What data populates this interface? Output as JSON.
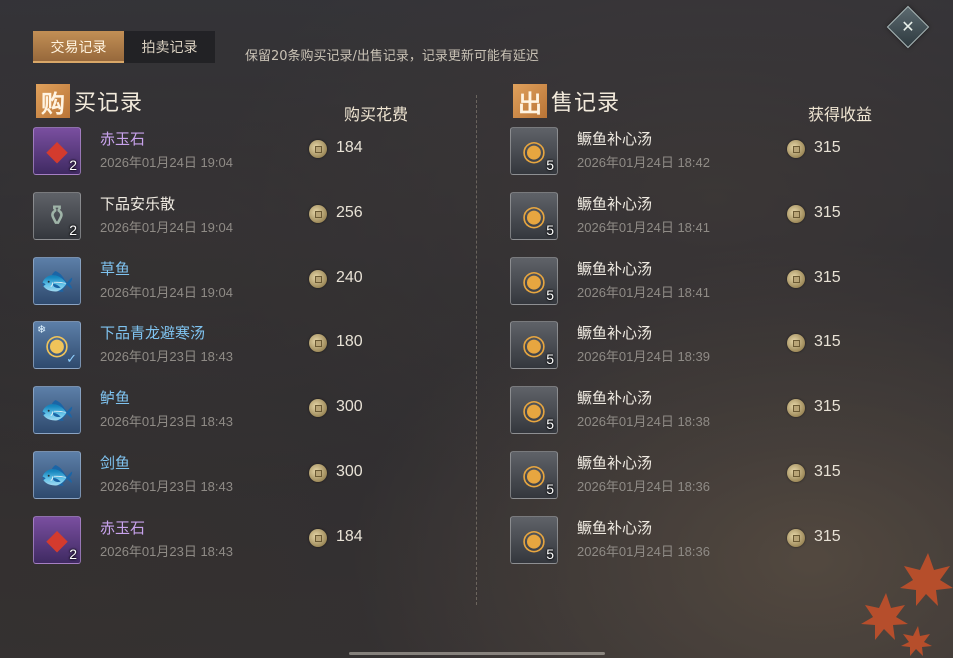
{
  "tabs": [
    {
      "label": "交易记录",
      "active": true
    },
    {
      "label": "拍卖记录",
      "active": false
    }
  ],
  "notice": "保留20条购买记录/出售记录，记录更新可能有延迟",
  "close_icon": "close-diamond-icon",
  "buy": {
    "title_char": "购",
    "title_rest": "买记录",
    "col_header": "购买花费",
    "items": [
      {
        "name": "赤玉石",
        "name_color": "purple",
        "time": "2026年01月24日 19:04",
        "amount": "184",
        "qty": "2",
        "icon": "red-gem-icon",
        "frame": "purple"
      },
      {
        "name": "下品安乐散",
        "name_color": "white",
        "time": "2026年01月24日 19:04",
        "amount": "256",
        "qty": "2",
        "icon": "medicine-jar-icon",
        "frame": "gray"
      },
      {
        "name": "草鱼",
        "name_color": "blue",
        "time": "2026年01月24日 19:04",
        "amount": "240",
        "qty": "",
        "icon": "grass-carp-icon",
        "frame": "blue"
      },
      {
        "name": "下品青龙避寒汤",
        "name_color": "blue",
        "time": "2026年01月23日 18:43",
        "amount": "180",
        "qty": "",
        "icon": "soup-bowl-icon",
        "frame": "blue"
      },
      {
        "name": "鲈鱼",
        "name_color": "blue",
        "time": "2026年01月23日 18:43",
        "amount": "300",
        "qty": "",
        "icon": "perch-fish-icon",
        "frame": "blue"
      },
      {
        "name": "剑鱼",
        "name_color": "blue",
        "time": "2026年01月23日 18:43",
        "amount": "300",
        "qty": "",
        "icon": "swordfish-icon",
        "frame": "blue"
      },
      {
        "name": "赤玉石",
        "name_color": "purple",
        "time": "2026年01月23日 18:43",
        "amount": "184",
        "qty": "2",
        "icon": "red-gem-icon",
        "frame": "purple"
      }
    ]
  },
  "sell": {
    "title_char": "出",
    "title_rest": "售记录",
    "col_header": "获得收益",
    "items": [
      {
        "name": "鳜鱼补心汤",
        "name_color": "white",
        "time": "2026年01月24日 18:42",
        "amount": "315",
        "qty": "5",
        "icon": "fish-soup-icon",
        "frame": "gray"
      },
      {
        "name": "鳜鱼补心汤",
        "name_color": "white",
        "time": "2026年01月24日 18:41",
        "amount": "315",
        "qty": "5",
        "icon": "fish-soup-icon",
        "frame": "gray"
      },
      {
        "name": "鳜鱼补心汤",
        "name_color": "white",
        "time": "2026年01月24日 18:41",
        "amount": "315",
        "qty": "5",
        "icon": "fish-soup-icon",
        "frame": "gray"
      },
      {
        "name": "鳜鱼补心汤",
        "name_color": "white",
        "time": "2026年01月24日 18:39",
        "amount": "315",
        "qty": "5",
        "icon": "fish-soup-icon",
        "frame": "gray"
      },
      {
        "name": "鳜鱼补心汤",
        "name_color": "white",
        "time": "2026年01月24日 18:38",
        "amount": "315",
        "qty": "5",
        "icon": "fish-soup-icon",
        "frame": "gray"
      },
      {
        "name": "鳜鱼补心汤",
        "name_color": "white",
        "time": "2026年01月24日 18:36",
        "amount": "315",
        "qty": "5",
        "icon": "fish-soup-icon",
        "frame": "gray"
      },
      {
        "name": "鳜鱼补心汤",
        "name_color": "white",
        "time": "2026年01月24日 18:36",
        "amount": "315",
        "qty": "5",
        "icon": "fish-soup-icon",
        "frame": "gray"
      }
    ]
  },
  "colors": {
    "accent": "#c28f55",
    "purple_name": "#c8a2ec",
    "blue_name": "#7fc3f0"
  }
}
